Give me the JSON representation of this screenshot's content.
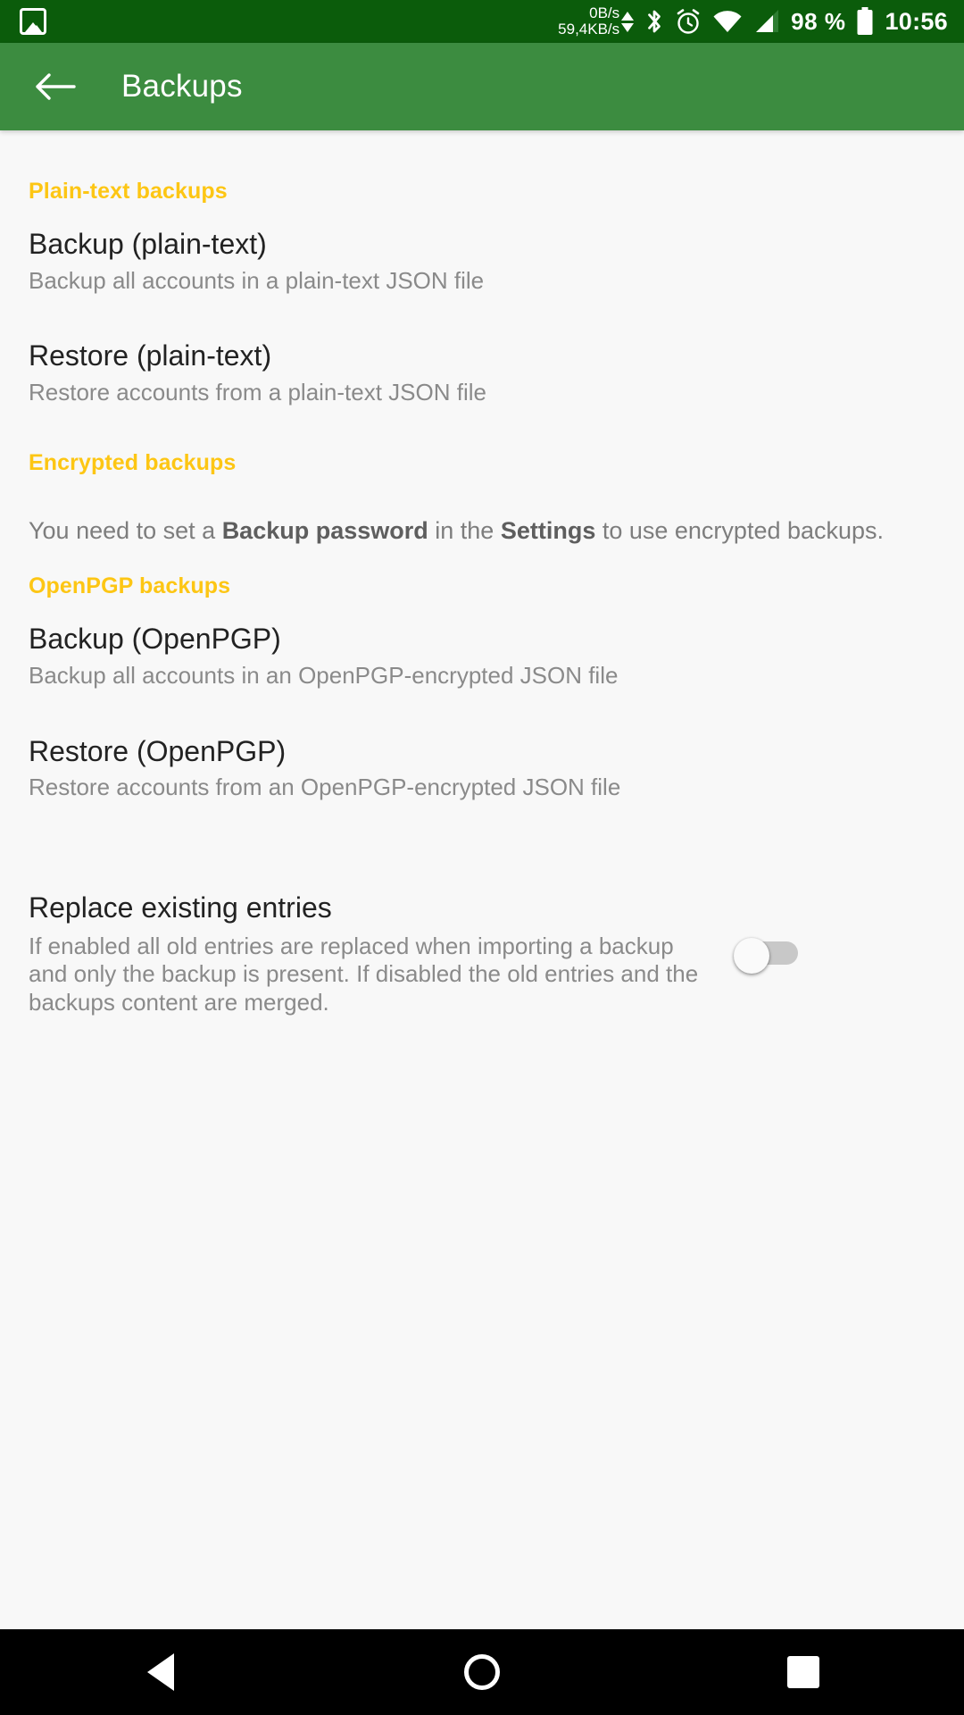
{
  "status_bar": {
    "notification_icon": "photo-icon",
    "net_speed_up": "0B/s",
    "net_speed_down": "59,4KB/s",
    "bluetooth_icon": "bluetooth-icon",
    "alarm_icon": "alarm-clock-icon",
    "wifi_icon": "wifi-icon",
    "signal_icon": "cell-signal-icon",
    "battery_percent": "98 %",
    "battery_icon": "battery-full-icon",
    "time": "10:56",
    "background_color": "#0b5c0b"
  },
  "app_bar": {
    "back_icon": "arrow-left-icon",
    "title": "Backups",
    "background_color": "#3c8c40"
  },
  "sections": [
    {
      "header": "Plain-text backups",
      "items": [
        {
          "title": "Backup (plain-text)",
          "summary": "Backup all accounts in a plain-text JSON file"
        },
        {
          "title": "Restore (plain-text)",
          "summary": "Restore accounts from a plain-text JSON file"
        }
      ]
    },
    {
      "header": "Encrypted backups",
      "info_parts": {
        "p1": "You need to set a ",
        "b1": "Backup password",
        "p2": " in the ",
        "b2": "Settings",
        "p3": " to use encrypted backups."
      }
    },
    {
      "header": "OpenPGP backups",
      "items": [
        {
          "title": "Backup (OpenPGP)",
          "summary": "Backup all accounts in an OpenPGP-encrypted JSON file"
        },
        {
          "title": "Restore (OpenPGP)",
          "summary": "Restore accounts from an OpenPGP-encrypted JSON file"
        }
      ]
    }
  ],
  "switch_preference": {
    "title": "Replace existing entries",
    "summary": "If enabled all old entries are replaced when importing a backup and only the backup is present. If disabled the old entries and the backups content are merged.",
    "state": "off"
  },
  "nav_bar": {
    "back_icon": "nav-back-triangle-icon",
    "home_icon": "nav-home-circle-icon",
    "recents_icon": "nav-recents-square-icon"
  },
  "theme": {
    "accent_header": "#fdc614",
    "primary": "#3c8c40",
    "primary_dark": "#0b5c0b",
    "background": "#f8f8f8",
    "title_text": "#222222",
    "summary_text": "#8a8a8a"
  }
}
